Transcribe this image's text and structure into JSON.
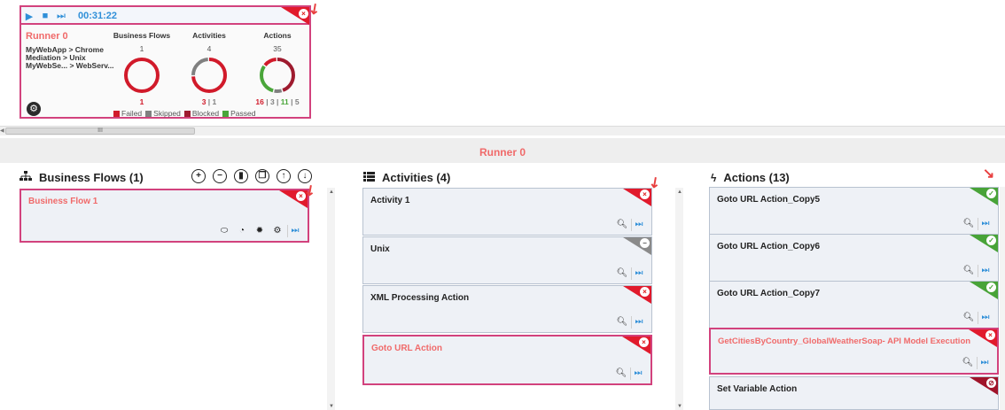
{
  "runner_card": {
    "time": "00:31:22",
    "name": "Runner 0",
    "lines": [
      "MyWebApp > Chrome",
      "Mediation > Unix",
      "MyWebSe... > WebServ..."
    ],
    "stats": [
      {
        "header": "Business Flows",
        "count": "1",
        "footer": [
          {
            "text": "1",
            "color": "red"
          }
        ]
      },
      {
        "header": "Activities",
        "count": "4",
        "footer": [
          {
            "text": "3",
            "color": "red"
          },
          {
            "text": " | ",
            "color": "gray"
          },
          {
            "text": "1",
            "color": "gray"
          }
        ]
      },
      {
        "header": "Actions",
        "count": "35",
        "footer": [
          {
            "text": "16",
            "color": "red"
          },
          {
            "text": " | ",
            "color": "gray"
          },
          {
            "text": "3",
            "color": "gray"
          },
          {
            "text": " | ",
            "color": "gray"
          },
          {
            "text": "11",
            "color": "green"
          },
          {
            "text": " | ",
            "color": "gray"
          },
          {
            "text": "5",
            "color": "gray"
          }
        ]
      }
    ],
    "donuts": [
      {
        "segments": [
          {
            "value": 1,
            "color": "#d11a2a"
          }
        ]
      },
      {
        "segments": [
          {
            "value": 3,
            "color": "#d11a2a"
          },
          {
            "value": 1,
            "color": "#808080"
          }
        ]
      },
      {
        "segments": [
          {
            "value": 16,
            "color": "#9e1b2f"
          },
          {
            "value": 3,
            "color": "#808080"
          },
          {
            "value": 11,
            "color": "#4aa63a"
          },
          {
            "value": 5,
            "color": "#d11a2a"
          }
        ]
      }
    ],
    "legend": [
      {
        "label": "Failed",
        "color": "#d11a2a"
      },
      {
        "label": "Skipped",
        "color": "#808080"
      },
      {
        "label": "Blocked",
        "color": "#9e1b2f"
      },
      {
        "label": "Passed",
        "color": "#4aa63a"
      }
    ]
  },
  "scrollbar": {
    "thumb_grip": "III"
  },
  "banner": {
    "title": "Runner 0"
  },
  "business_flows": {
    "title": "Business Flows (1)",
    "items": [
      {
        "name": "Business Flow 1",
        "status": "failed"
      }
    ]
  },
  "activities": {
    "title": "Activities (4)",
    "items": [
      {
        "name": "Activity 1",
        "status": "failed"
      },
      {
        "name": "Unix",
        "status": "skipped"
      },
      {
        "name": "XML Processing Action",
        "status": "failed"
      },
      {
        "name": "Goto URL Action",
        "status": "failed"
      }
    ]
  },
  "actions": {
    "title": "Actions (13)",
    "items": [
      {
        "name": "Goto URL Action_Copy5",
        "status": "passed"
      },
      {
        "name": "Goto URL Action_Copy6",
        "status": "passed"
      },
      {
        "name": "Goto URL Action_Copy7",
        "status": "passed"
      },
      {
        "name": "GetCitiesByCountry_GlobalWeatherSoap- API Model Execution",
        "status": "failed"
      },
      {
        "name": "Set Variable Action",
        "status": "blocked"
      }
    ]
  },
  "colors": {
    "accent": "#d2427d",
    "title_pink": "#f06a6a",
    "blue": "#2f8fd8",
    "failed": "#e11a2c",
    "passed": "#48a338",
    "skipped": "#8a8a8a",
    "blocked": "#a0142a"
  }
}
